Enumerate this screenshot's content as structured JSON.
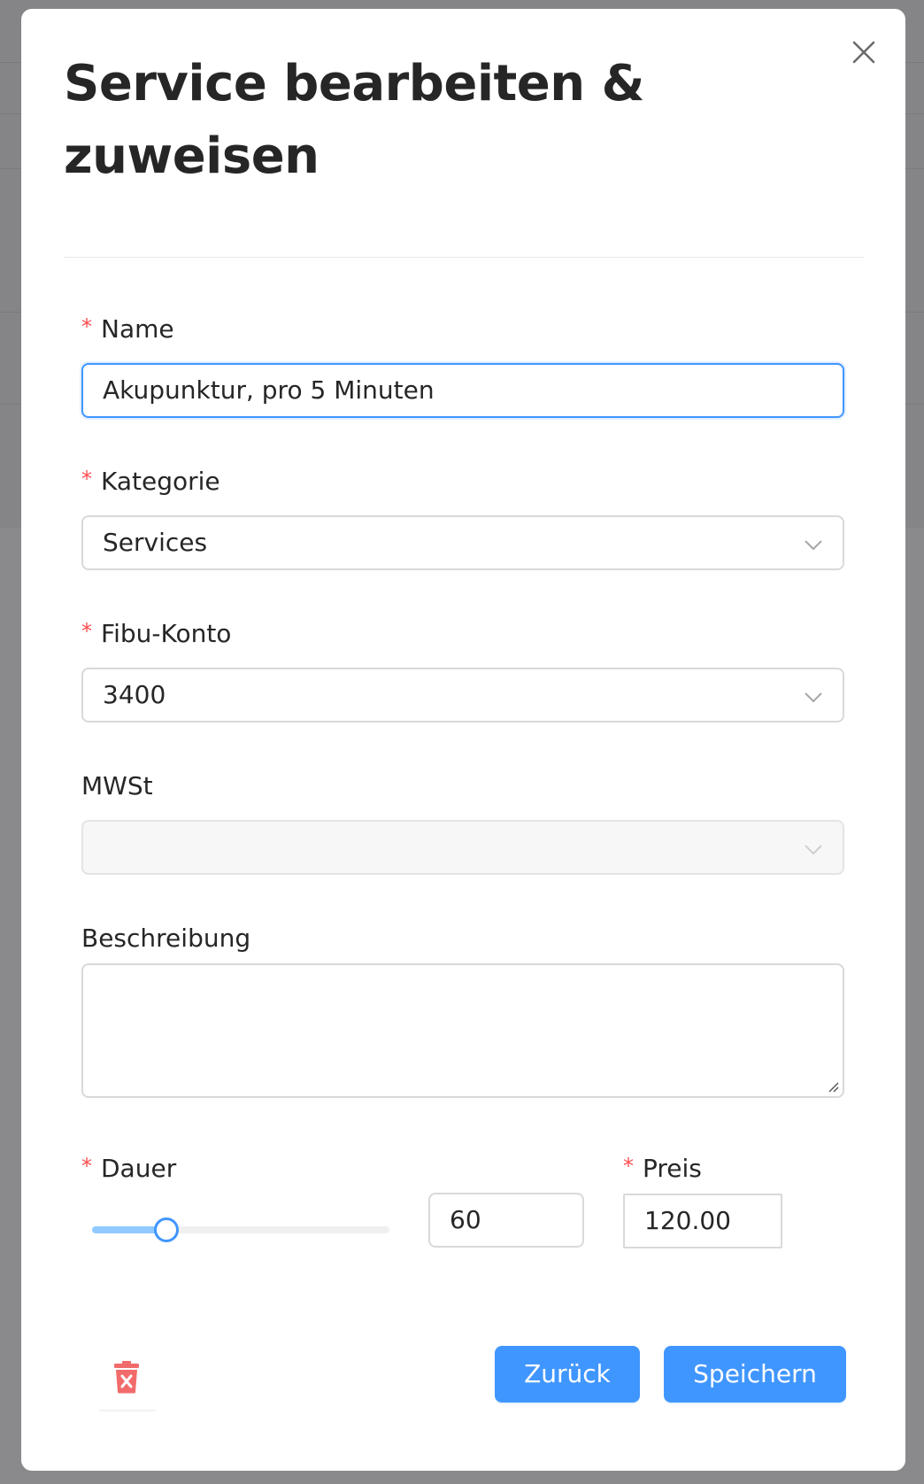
{
  "modal": {
    "title": "Service bearbeiten & zuweisen",
    "close_icon": "close-icon"
  },
  "fields": {
    "name": {
      "label": "Name",
      "required_mark": "*",
      "value": "Akupunktur, pro 5 Minuten"
    },
    "kategorie": {
      "label": "Kategorie",
      "required_mark": "*",
      "value": "Services"
    },
    "fibu_konto": {
      "label": "Fibu-Konto",
      "required_mark": "*",
      "value": "3400"
    },
    "mwst": {
      "label": "MWSt",
      "value": ""
    },
    "beschreibung": {
      "label": "Beschreibung",
      "value": ""
    },
    "dauer": {
      "label": "Dauer",
      "required_mark": "*",
      "value": "60",
      "slider_fraction": 0.25
    },
    "preis": {
      "label": "Preis",
      "required_mark": "*",
      "value": "120.00"
    }
  },
  "footer": {
    "delete_icon": "trash-icon",
    "back_label": "Zurück",
    "save_label": "Speichern"
  },
  "colors": {
    "primary": "#4096ff",
    "required": "#ff4d4f",
    "delete": "#ff6b6b"
  }
}
